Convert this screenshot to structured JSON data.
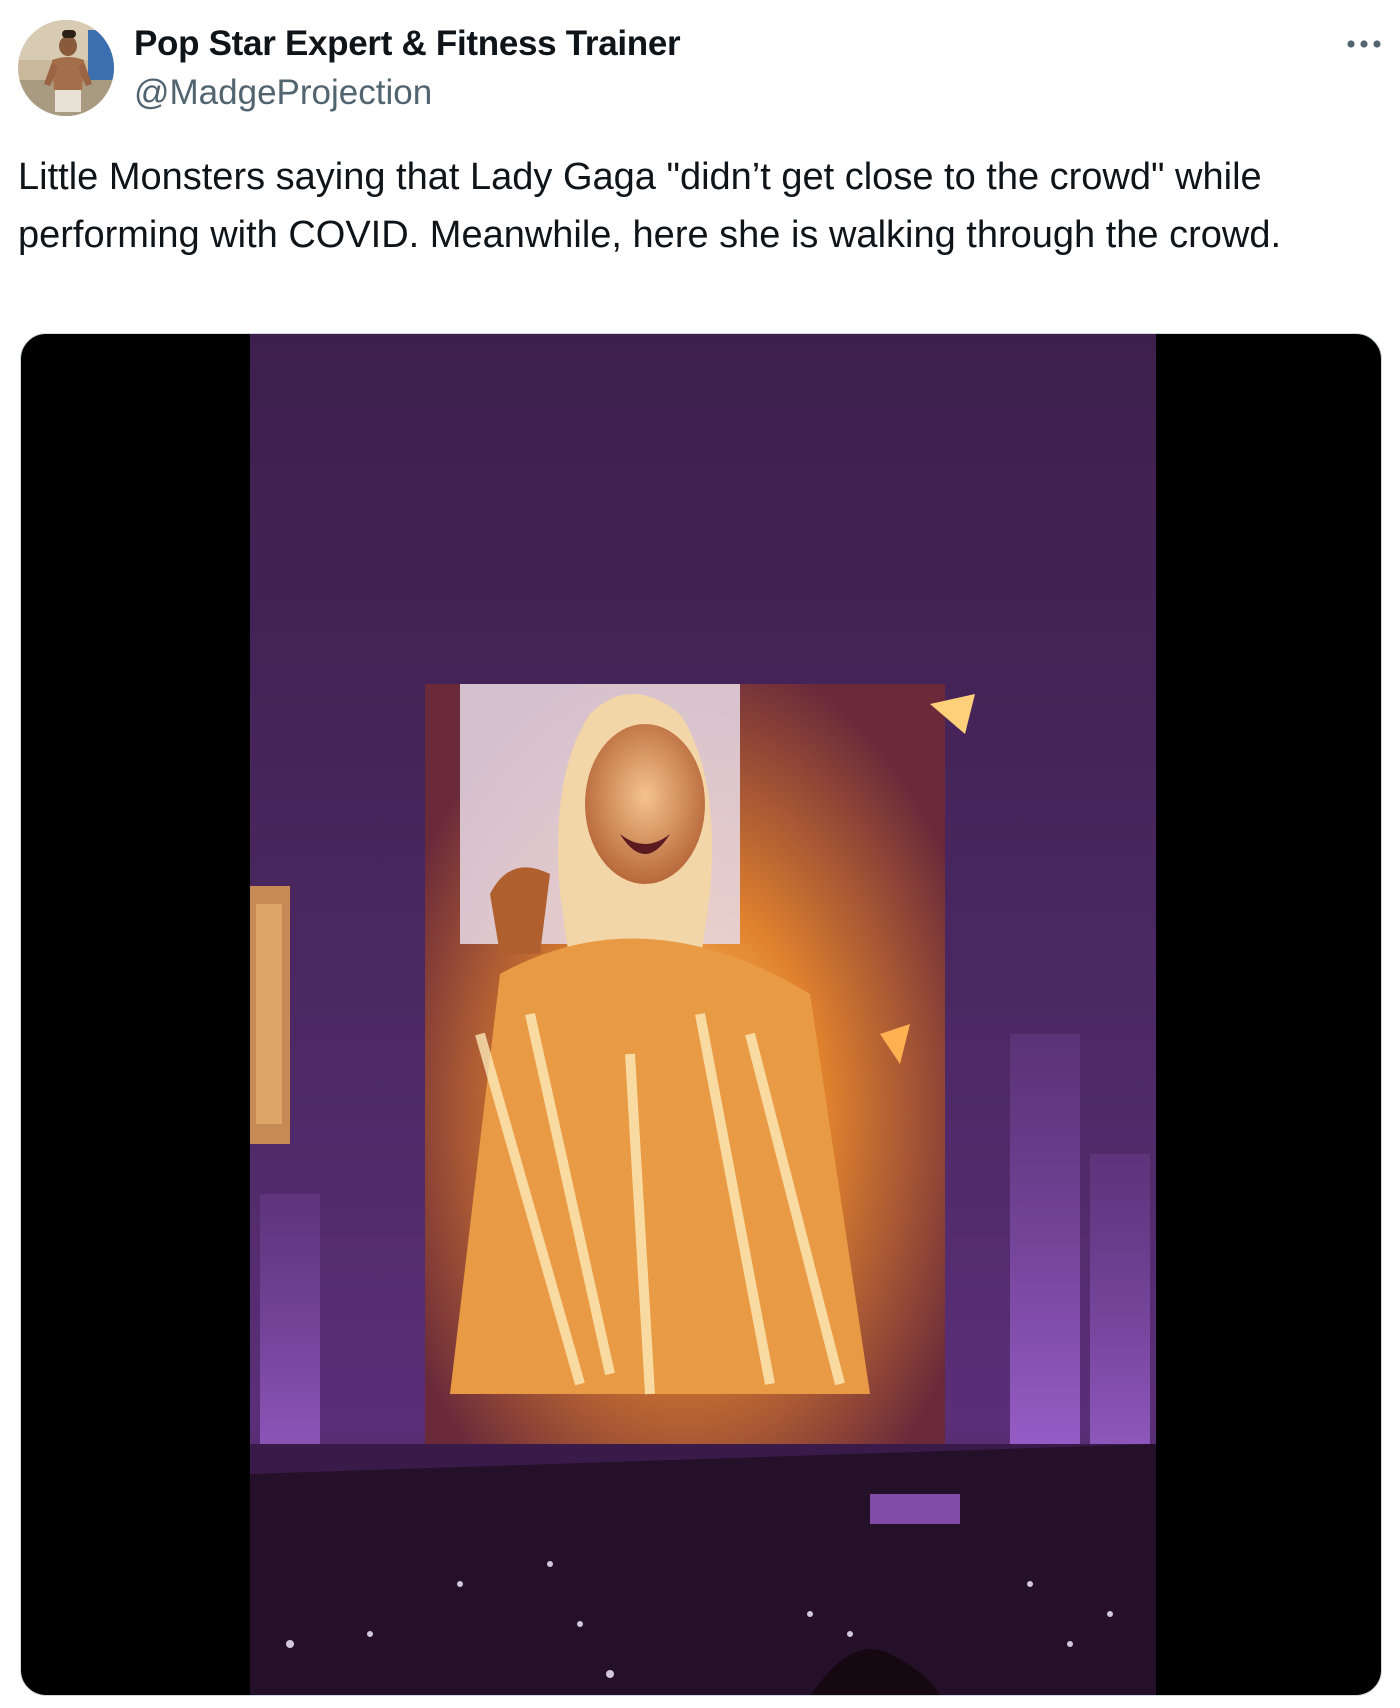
{
  "author": {
    "display_name": "Pop Star Expert & Fitness Trainer",
    "handle": "@MadgeProjection",
    "avatar_icon": "profile-photo-avatar"
  },
  "menu": {
    "icon": "more-options-icon"
  },
  "tweet": {
    "text": "Little Monsters saying that Lady Gaga \"didn’t get close to the crowd\" while performing with COVID. Meanwhile, here she is walking through the crowd."
  },
  "media": {
    "type": "video",
    "letterbox_color": "#000000"
  },
  "colors": {
    "text_primary": "#0f1419",
    "text_secondary": "#536471",
    "stage_purple": "#6b2d8f",
    "screen_orange": "#f0a040"
  }
}
